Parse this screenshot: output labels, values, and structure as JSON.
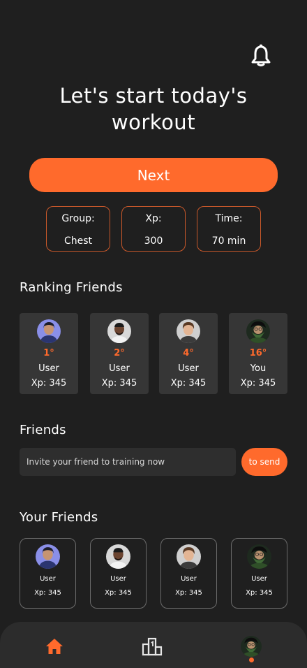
{
  "header": {
    "title": "Let's start today's workout",
    "notifications_icon": "bell-icon"
  },
  "actions": {
    "next_label": "Next"
  },
  "stats": [
    {
      "label": "Group:",
      "value": "Chest"
    },
    {
      "label": "Xp:",
      "value": "300"
    },
    {
      "label": "Time:",
      "value": "70 min"
    }
  ],
  "ranking": {
    "title": "Ranking Friends",
    "items": [
      {
        "position": "1°",
        "name": "User",
        "xp": "Xp: 345"
      },
      {
        "position": "2°",
        "name": "User",
        "xp": "Xp: 345"
      },
      {
        "position": "4°",
        "name": "User",
        "xp": "Xp: 345"
      },
      {
        "position": "16°",
        "name": "You",
        "xp": "Xp: 345"
      }
    ]
  },
  "friends": {
    "title": "Friends",
    "invite_placeholder": "Invite your friend to training now",
    "send_label": "to send"
  },
  "your_friends": {
    "title": "Your Friends",
    "items": [
      {
        "name": "User",
        "xp": "Xp: 345"
      },
      {
        "name": "User",
        "xp": "Xp: 345"
      },
      {
        "name": "User",
        "xp": "Xp: 345"
      },
      {
        "name": "User",
        "xp": "Xp: 345"
      }
    ]
  },
  "tabbar": {
    "tabs": [
      "home-icon",
      "ranking-icon",
      "profile-avatar"
    ],
    "active": "home"
  },
  "colors": {
    "accent": "#ff6a2c",
    "background": "#1f1f1f",
    "card": "#363636"
  }
}
